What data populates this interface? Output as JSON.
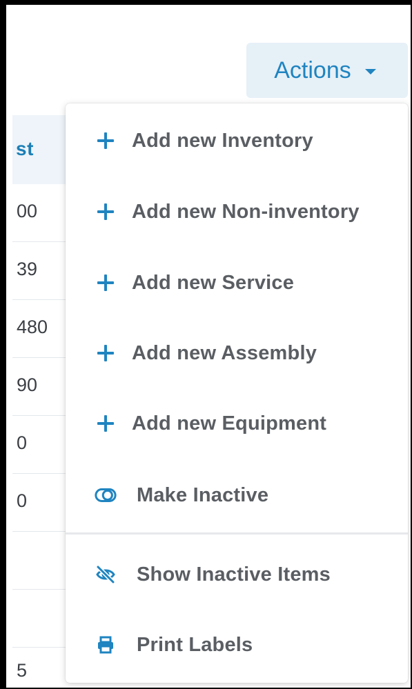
{
  "actions_button": {
    "label": "Actions",
    "caret_icon": "caret-down-icon"
  },
  "background_table": {
    "header_partial": "st",
    "cells_partial": [
      "00",
      "39",
      "480",
      "90",
      "0",
      "0",
      "",
      "",
      "5"
    ]
  },
  "menu": {
    "items": [
      {
        "label": "Add new Inventory",
        "icon": "plus-icon"
      },
      {
        "label": "Add new Non-inventory",
        "icon": "plus-icon"
      },
      {
        "label": "Add new Service",
        "icon": "plus-icon"
      },
      {
        "label": "Add new Assembly",
        "icon": "plus-icon"
      },
      {
        "label": "Add new Equipment",
        "icon": "plus-icon"
      },
      {
        "label": "Make Inactive",
        "icon": "toggle-icon"
      },
      {
        "label": "Show Inactive Items",
        "icon": "eye-slash-icon"
      },
      {
        "label": "Print Labels",
        "icon": "printer-icon"
      }
    ]
  },
  "colors": {
    "accent": "#1f84c0",
    "button_bg": "#e6f0f7",
    "menu_text": "#5a5e63",
    "table_header_bg": "#eef4f9"
  }
}
